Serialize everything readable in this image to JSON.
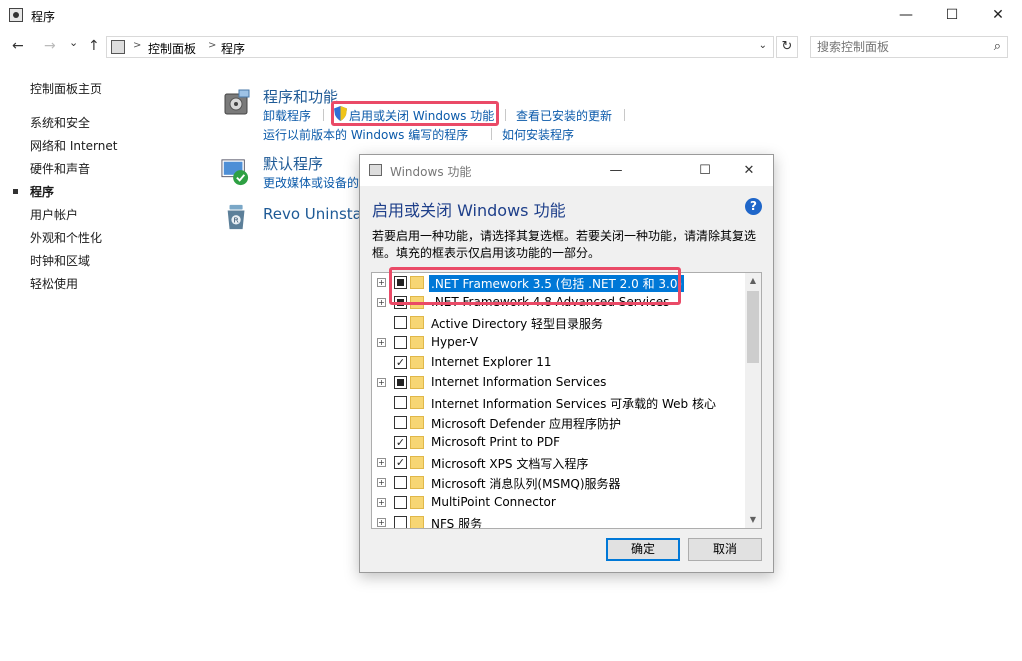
{
  "window": {
    "title": "程序",
    "minimize_glyph": "—",
    "maximize_glyph": "☐",
    "close_glyph": "✕"
  },
  "nav": {
    "back_glyph": "←",
    "forward_glyph": "→",
    "recent_glyph": "⌄",
    "up_glyph": "↑",
    "breadcrumb": [
      "控制面板",
      "程序"
    ],
    "separator_glyph": ">",
    "dropdown_glyph": "⌄",
    "refresh_glyph": "↻",
    "search_placeholder": "搜索控制面板",
    "search_glyph": "⌕"
  },
  "sidebar": {
    "home": "控制面板主页",
    "items": [
      {
        "label": "系统和安全",
        "current": false
      },
      {
        "label": "网络和 Internet",
        "current": false
      },
      {
        "label": "硬件和声音",
        "current": false
      },
      {
        "label": "程序",
        "current": true
      },
      {
        "label": "用户帐户",
        "current": false
      },
      {
        "label": "外观和个性化",
        "current": false
      },
      {
        "label": "时钟和区域",
        "current": false
      },
      {
        "label": "轻松使用",
        "current": false
      }
    ]
  },
  "main": {
    "programs": {
      "title": "程序和功能",
      "links": [
        "卸载程序",
        "启用或关闭 Windows 功能",
        "查看已安装的更新",
        "运行以前版本的 Windows 编写的程序",
        "如何安装程序"
      ]
    },
    "default_programs": {
      "title": "默认程序",
      "link": "更改媒体或设备的"
    },
    "revo": {
      "title": "Revo Uninsta"
    }
  },
  "dialog": {
    "title": "Windows 功能",
    "heading": "启用或关闭 Windows 功能",
    "help_glyph": "?",
    "description": "若要启用一种功能，请选择其复选框。若要关闭一种功能，请清除其复选框。填充的框表示仅启用该功能的一部分。",
    "features": [
      {
        "label": ".NET Framework 3.5 (包括 .NET 2.0 和 3.0)",
        "expandable": true,
        "state": "partial",
        "selected": true
      },
      {
        "label": ".NET Framework 4.8 Advanced Services",
        "expandable": true,
        "state": "partial",
        "selected": false
      },
      {
        "label": "Active Directory 轻型目录服务",
        "expandable": false,
        "state": "unchecked",
        "selected": false
      },
      {
        "label": "Hyper-V",
        "expandable": true,
        "state": "unchecked",
        "selected": false
      },
      {
        "label": "Internet Explorer 11",
        "expandable": false,
        "state": "checked",
        "selected": false
      },
      {
        "label": "Internet Information Services",
        "expandable": true,
        "state": "partial",
        "selected": false
      },
      {
        "label": "Internet Information Services 可承载的 Web 核心",
        "expandable": false,
        "state": "unchecked",
        "selected": false
      },
      {
        "label": "Microsoft Defender 应用程序防护",
        "expandable": false,
        "state": "unchecked",
        "selected": false
      },
      {
        "label": "Microsoft Print to PDF",
        "expandable": false,
        "state": "checked",
        "selected": false
      },
      {
        "label": "Microsoft XPS 文档写入程序",
        "expandable": true,
        "state": "checked",
        "selected": false
      },
      {
        "label": "Microsoft 消息队列(MSMQ)服务器",
        "expandable": true,
        "state": "unchecked",
        "selected": false
      },
      {
        "label": "MultiPoint Connector",
        "expandable": true,
        "state": "unchecked",
        "selected": false
      },
      {
        "label": "NFS 服务",
        "expandable": true,
        "state": "unchecked",
        "selected": false
      }
    ],
    "expand_glyph": "+",
    "check_glyph": "✓",
    "scroll_up_glyph": "▲",
    "scroll_down_glyph": "▼",
    "ok_label": "确定",
    "cancel_label": "取消"
  },
  "colors": {
    "link": "#0b5aaa",
    "section_title": "#1e5a96",
    "highlight_box": "#ea4a67",
    "selection": "#0078d7"
  }
}
